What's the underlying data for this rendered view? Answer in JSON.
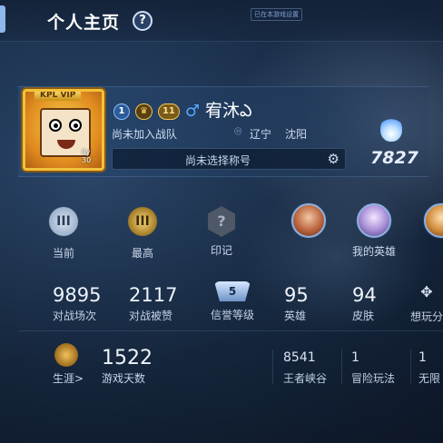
{
  "header": {
    "title": "个人主页",
    "help_icon": "?",
    "visibility_note": "已在本游戏设置"
  },
  "profile": {
    "avatar_vip_badge": "KPL VIP",
    "avatar_caption": "Ily 30",
    "badges": {
      "level1": "1",
      "level2": "11",
      "gender_icon": "male-icon"
    },
    "name": "宥沐ఎ",
    "team": "尚未加入战队",
    "location_province": "辽宁",
    "location_city": "沈阳",
    "title_placeholder": "尚未选择称号",
    "power": "7827"
  },
  "icons": {
    "current_rank_label": "当前",
    "current_rank_glyph": "III",
    "best_rank_label": "最高",
    "best_rank_glyph": "III",
    "mark_label": "印记",
    "mark_glyph": "?",
    "my_heroes_label": "我的英雄"
  },
  "stats": {
    "matches_value": "9895",
    "matches_label": "对战场次",
    "likes_value": "2117",
    "likes_label": "对战被赞",
    "credit_value": "5",
    "credit_label": "信誉等级",
    "heroes_value": "95",
    "heroes_label": "英雄",
    "skins_value": "94",
    "skins_label": "皮肤",
    "fun_label": "想玩分"
  },
  "career": {
    "label": "生涯>",
    "days_value": "1522",
    "days_label": "游戏天数",
    "wangzhe_value": "8541",
    "wangzhe_label": "王者峡谷",
    "adventure_value": "1",
    "adventure_label": "冒险玩法",
    "unlimited_value": "1",
    "unlimited_label": "无限"
  }
}
